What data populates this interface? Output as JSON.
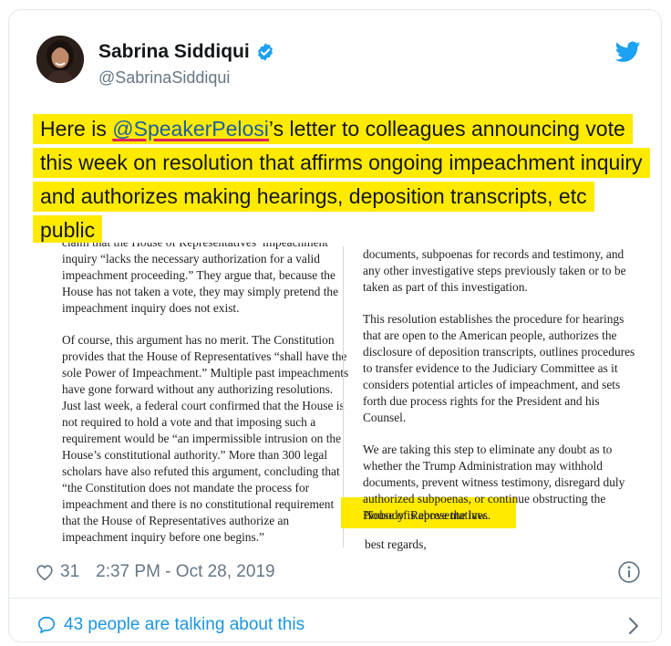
{
  "author": {
    "name": "Sabrina Siddiqui",
    "handle": "@SabrinaSiddiqui",
    "verified": true,
    "avatar_icon": "profile-photo"
  },
  "brand": {
    "icon": "twitter-bird-icon",
    "color": "#1da1f2"
  },
  "tweet": {
    "prefix": "Here is ",
    "mention": "@SpeakerPelosi",
    "suffix": "’s letter to colleagues announcing vote this week on resolution that affirms ongoing impeachment inquiry and authorizes making hearings, deposition transcripts, etc public",
    "highlight_color": "#ffea00"
  },
  "document": {
    "left_column": [
      "claim that the House of Representatives’ impeachment inquiry “lacks the necessary authorization for a valid impeachment proceeding.” They argue that, because the House has not taken a vote, they may simply pretend the impeachment inquiry does not exist.",
      "Of course, this argument has no merit. The Constitution provides that the House of Representatives “shall have the sole Power of Impeachment.” Multiple past impeachments have gone forward without any authorizing resolutions. Just last week, a federal court confirmed that the House is not required to hold a vote and that imposing such a requirement would be “an impermissible intrusion on the House’s constitutional authority.” More than 300 legal scholars have also refuted this argument, concluding that “the Constitution does not mandate the process for impeachment and there is no constitutional requirement that the House of Representatives authorize an impeachment inquiry before one begins.”"
    ],
    "right_column": [
      "documents, subpoenas for records and testimony, and any other investigative steps previously taken or to be taken as part of this investigation.",
      "This resolution establishes the procedure for hearings that are open to the American people, authorizes the disclosure of deposition transcripts, outlines procedures to transfer evidence to the Judiciary Committee as it considers potential articles of impeachment, and sets forth due process rights for the President and his Counsel.",
      "We are taking this step to eliminate any doubt as to whether the Trump Administration may withhold documents, prevent witness testimony, disregard duly authorized subpoenas, or continue obstructing the House of Representatives."
    ],
    "highlighted_line": "Nobody is above the law.",
    "closing": "best regards,"
  },
  "footer": {
    "likes": "31",
    "timestamp": "2:37 PM - Oct 28, 2019",
    "talking": "43 people are talking about this",
    "accent_color": "#1b95e0"
  }
}
